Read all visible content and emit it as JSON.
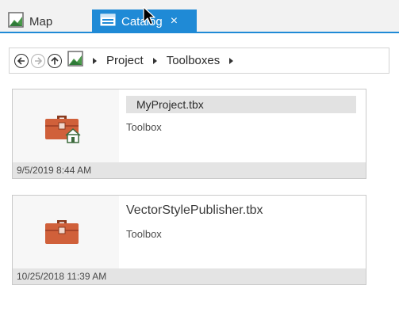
{
  "tabs": [
    {
      "label": "Map",
      "icon": "map-icon",
      "active": false
    },
    {
      "label": "Catalog",
      "icon": "catalog-icon",
      "active": true
    }
  ],
  "close_glyph": "×",
  "breadcrumb": {
    "items": [
      "Project",
      "Toolboxes"
    ]
  },
  "items": [
    {
      "name": "MyProject.tbx",
      "type": "Toolbox",
      "date": "9/5/2019 8:44 AM",
      "icon": "toolbox-home-icon",
      "selected": true
    },
    {
      "name": "VectorStylePublisher.tbx",
      "type": "Toolbox",
      "date": "10/25/2018 11:39 AM",
      "icon": "toolbox-icon",
      "selected": false
    }
  ],
  "colors": {
    "accent": "#1f8ad6",
    "toolbox": "#d0603a"
  }
}
